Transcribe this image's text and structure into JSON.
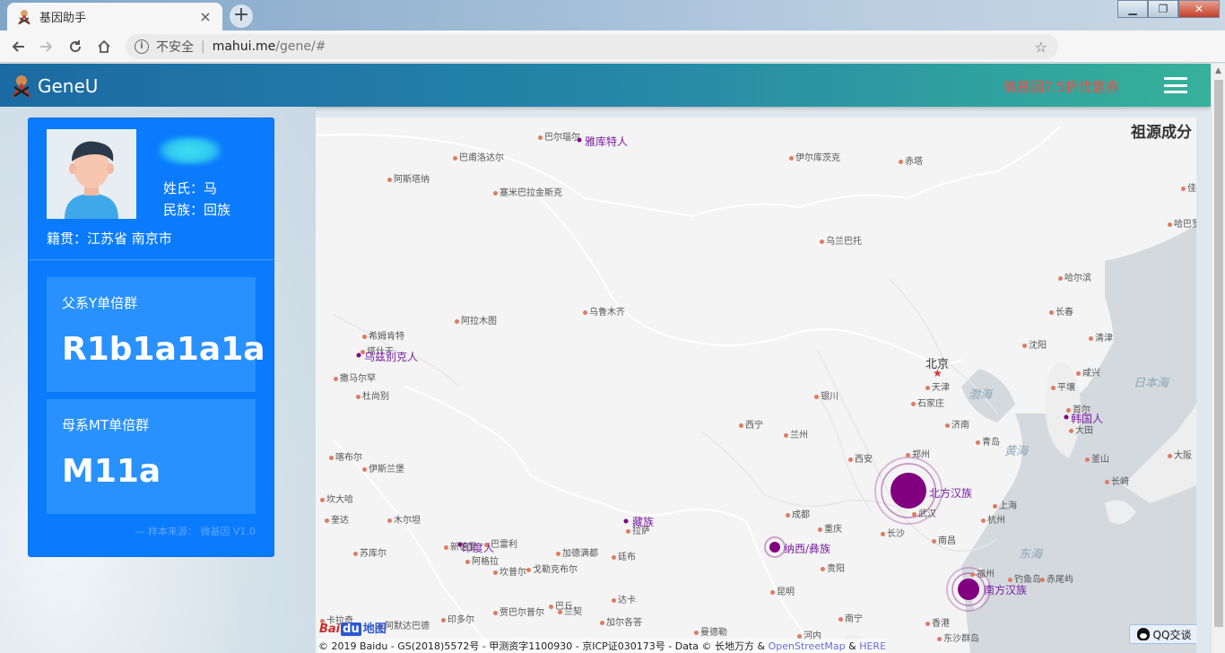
{
  "browser": {
    "tab_title": "基因助手",
    "new_tab": "+",
    "close_tab": "×",
    "insecure_label": "不安全",
    "url_host": "mahui.me",
    "url_path": "/gene/#",
    "window_controls": [
      "▁",
      "❐",
      "✕"
    ]
  },
  "app": {
    "logo_text": "GeneU",
    "promo": "微基因7.5折优惠券"
  },
  "profile": {
    "surname_label": "姓氏：马",
    "ethnicity_label": "民族：回族",
    "origin_label": "籍贯：江苏省 南京市",
    "paternal_label": "父系Y单倍群",
    "paternal_value": "R1b1a1a1a",
    "maternal_label": "母系MT单倍群",
    "maternal_value": "M11a",
    "source": "— 样本来源： 微基因 V1.0"
  },
  "map": {
    "title": "祖源成分",
    "beijing": "北京",
    "ethnic_labels": [
      {
        "id": "yakut",
        "text": "雅库特人"
      },
      {
        "id": "uzbek",
        "text": "乌兹别克人"
      },
      {
        "id": "tibetan",
        "text": "藏族"
      },
      {
        "id": "indian",
        "text": "印度人"
      },
      {
        "id": "naxi",
        "text": "纳西/彝族"
      },
      {
        "id": "north_han",
        "text": "北方汉族"
      },
      {
        "id": "south_han",
        "text": "南方汉族"
      },
      {
        "id": "korean",
        "text": "韩国人"
      }
    ],
    "cities": [
      "巴尔瑙尔",
      "巴甫洛达尔",
      "阿斯塔纳",
      "塞米巴拉金斯克",
      "伊尔库茨克",
      "赤塔",
      "乌兰巴托",
      "哈尔滨",
      "长春",
      "沈阳",
      "阿拉木图",
      "乌鲁木齐",
      "希姆肯特",
      "塔什干",
      "撒马尔罕",
      "杜尚别",
      "喀布尔",
      "伊斯兰堡",
      "坎大哈",
      "奎达",
      "木尔坦",
      "苏库尔",
      "新德里",
      "巴雷利",
      "阿格拉",
      "坎普尔",
      "戈勒克布尔",
      "加德满都",
      "廷布",
      "达卡",
      "巴丘",
      "银川",
      "西宁",
      "兰州",
      "西安",
      "郑州",
      "武汉",
      "成都",
      "重庆",
      "贵阳",
      "昆明",
      "南宁",
      "南昌",
      "福州",
      "香港",
      "石家庄",
      "济南",
      "天津",
      "平壤",
      "首尔",
      "大田",
      "釜山",
      "青岛",
      "上海",
      "杭州",
      "长沙",
      "拉萨",
      "卡拉奇",
      "阿默达巴德",
      "印多尔",
      "贾巴尔普尔",
      "兰契",
      "加尔各答",
      "曼德勒",
      "河内",
      "清津",
      "咸兴",
      "哈巴罗夫斯克",
      "佳木斯",
      "大阪",
      "长崎"
    ],
    "big_labels": [
      "日本海",
      "渤海",
      "黄海",
      "东海",
      "钓鱼岛",
      "赤尾屿",
      "东沙群岛"
    ],
    "baidu_logo": "Bai",
    "baidu_du": "du",
    "baidu_map": "地图",
    "copyright": "© 2019 Baidu - GS(2018)5572号 - 甲测资字1100930 - 京ICP证030173号 - Data © 长地万方 & ",
    "copyright_osm": "OpenStreetMap",
    "copyright_and": " & ",
    "copyright_here": "HERE",
    "qq_button": "QQ交谈"
  },
  "colors": {
    "appbar_start": "#1b6aa3",
    "appbar_end": "#36b19a",
    "card_blue": "#0a7bfd",
    "promo_red": "#e8524c",
    "marker_purple": "#800080"
  }
}
